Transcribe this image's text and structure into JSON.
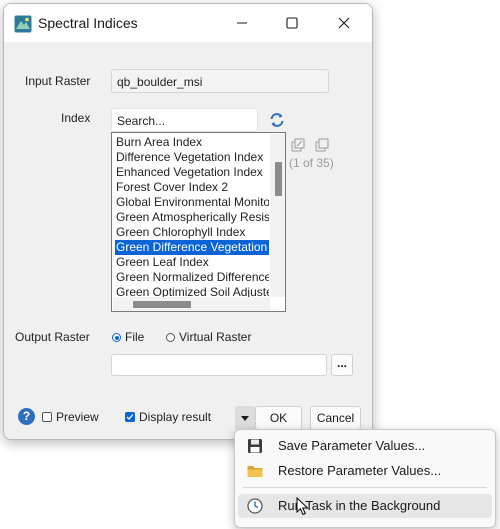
{
  "window": {
    "title": "Spectral Indices",
    "minimize_label": "Minimize",
    "maximize_label": "Maximize",
    "close_label": "Close"
  },
  "input_raster": {
    "label": "Input Raster",
    "value": "qb_boulder_msi"
  },
  "index": {
    "label": "Index",
    "search_placeholder": "Search...",
    "items": [
      "Burn Area Index",
      "Difference Vegetation Index",
      "Enhanced Vegetation Index",
      "Forest Cover Index 2",
      "Global Environmental Monitoring Index",
      "Green Atmospherically Resistant Index",
      "Green Chlorophyll Index",
      "Green Difference Vegetation Index",
      "Green Leaf Index",
      "Green Normalized Difference Vegetation Index",
      "Green Optimized Soil Adjusted Vegetation Index"
    ],
    "selected_index": 7,
    "count_text": "(1 of 35)",
    "vertical_scroll_fraction": 0.22
  },
  "output_raster": {
    "label": "Output Raster",
    "options": [
      "File",
      "Virtual Raster"
    ],
    "selected_option": "File",
    "filename_value": "",
    "browse_label": "..."
  },
  "footer": {
    "help_label": "?",
    "preview_label": "Preview",
    "preview_checked": false,
    "display_result_label": "Display result",
    "display_result_checked": true,
    "ok_label": "OK",
    "cancel_label": "Cancel"
  },
  "context_menu": {
    "items": [
      {
        "label": "Save Parameter Values...",
        "icon": "floppy-disk-icon"
      },
      {
        "label": "Restore Parameter Values...",
        "icon": "folder-icon"
      },
      {
        "label": "Run Task in the Background",
        "icon": "clock-icon",
        "hovered": true
      }
    ]
  },
  "colors": {
    "selection": "#0a64d6",
    "dialog_bg": "#f0f0f0",
    "accent_icon": "#2d6fbf"
  }
}
